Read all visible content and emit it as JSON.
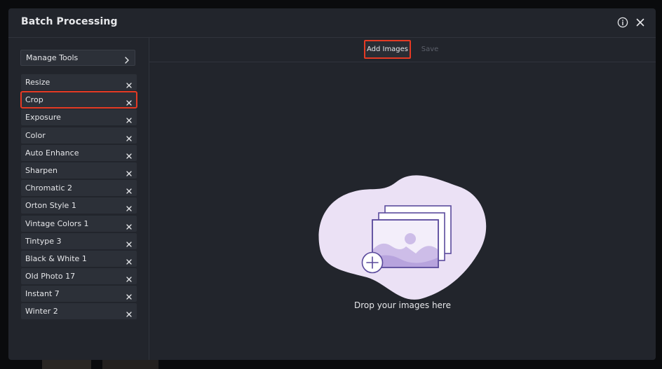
{
  "dialog": {
    "title": "Batch Processing"
  },
  "header": {
    "info_icon": "info-icon",
    "close_icon": "close-icon"
  },
  "sidebar": {
    "manage_tools_label": "Manage Tools",
    "tools": [
      {
        "label": "Resize",
        "selected": false
      },
      {
        "label": "Crop",
        "selected": true
      },
      {
        "label": "Exposure",
        "selected": false
      },
      {
        "label": "Color",
        "selected": false
      },
      {
        "label": "Auto Enhance",
        "selected": false
      },
      {
        "label": "Sharpen",
        "selected": false
      },
      {
        "label": "Chromatic 2",
        "selected": false
      },
      {
        "label": "Orton Style 1",
        "selected": false
      },
      {
        "label": "Vintage Colors 1",
        "selected": false
      },
      {
        "label": "Tintype 3",
        "selected": false
      },
      {
        "label": "Black & White 1",
        "selected": false
      },
      {
        "label": "Old Photo 17",
        "selected": false
      },
      {
        "label": "Instant 7",
        "selected": false
      },
      {
        "label": "Winter 2",
        "selected": false
      }
    ]
  },
  "toolbar": {
    "add_images_label": "Add Images",
    "save_label": "Save"
  },
  "dropzone": {
    "text": "Drop your images here"
  },
  "colors": {
    "accent_highlight": "#e53a24",
    "panel": "#22252c",
    "item": "#2c3038",
    "illustration_blob": "#ebe1f5",
    "illustration_stroke": "#5a4a9c"
  }
}
